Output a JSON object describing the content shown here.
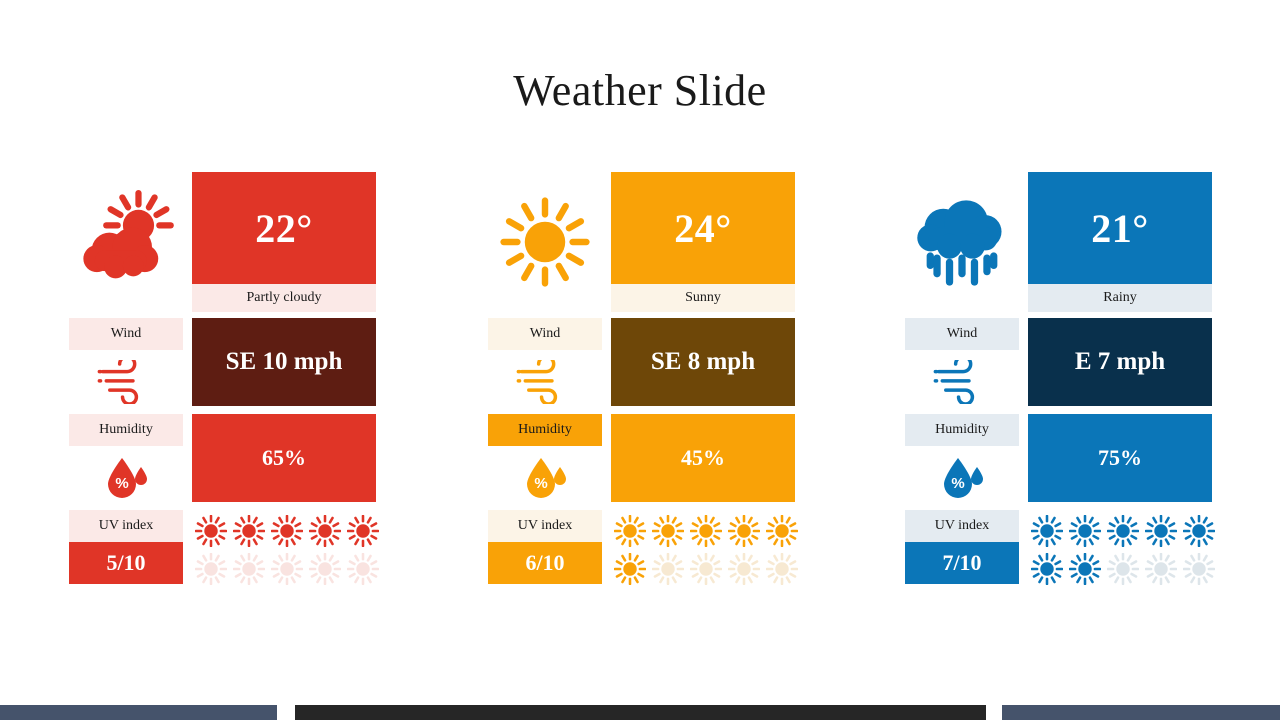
{
  "title": "Weather Slide",
  "labels": {
    "wind": "Wind",
    "humidity": "Humidity",
    "uv": "UV index"
  },
  "uv_scale_max": 10,
  "uv_icon_count": 10,
  "columns": [
    {
      "condition_icon": "sun-behind-cloud-icon",
      "temperature": "22°",
      "condition": "Partly cloudy",
      "wind": "SE 10 mph",
      "humidity": "65%",
      "uv": "5/10",
      "uv_filled": 5,
      "colors": {
        "main": "#e03527",
        "dark": "#5e1d12",
        "tint": "#fce0dd",
        "faint": "#fbe9e7",
        "pale": "#f9e3e0"
      }
    },
    {
      "condition_icon": "sun-icon",
      "temperature": "24°",
      "condition": "Sunny",
      "wind": "SE 8 mph",
      "humidity": "45%",
      "uv": "6/10",
      "uv_filled": 6,
      "colors": {
        "main": "#f9a207",
        "dark": "#6e4708",
        "tint": "#fdf3e2",
        "faint": "#fcf4e7",
        "pale": "#f7e9d2"
      }
    },
    {
      "condition_icon": "rain-cloud-icon",
      "temperature": "21°",
      "condition": "Rainy",
      "wind": "E 7 mph",
      "humidity": "75%",
      "uv": "7/10",
      "uv_filled": 7,
      "colors": {
        "main": "#0b76b8",
        "dark": "#09304c",
        "tint": "#e6eff2",
        "faint": "#e4ebf1",
        "pale": "#dde5ea"
      }
    }
  ],
  "bottom_bar": {
    "left_color": "#45536b",
    "center_color": "#262626",
    "right_color": "#45536b"
  }
}
